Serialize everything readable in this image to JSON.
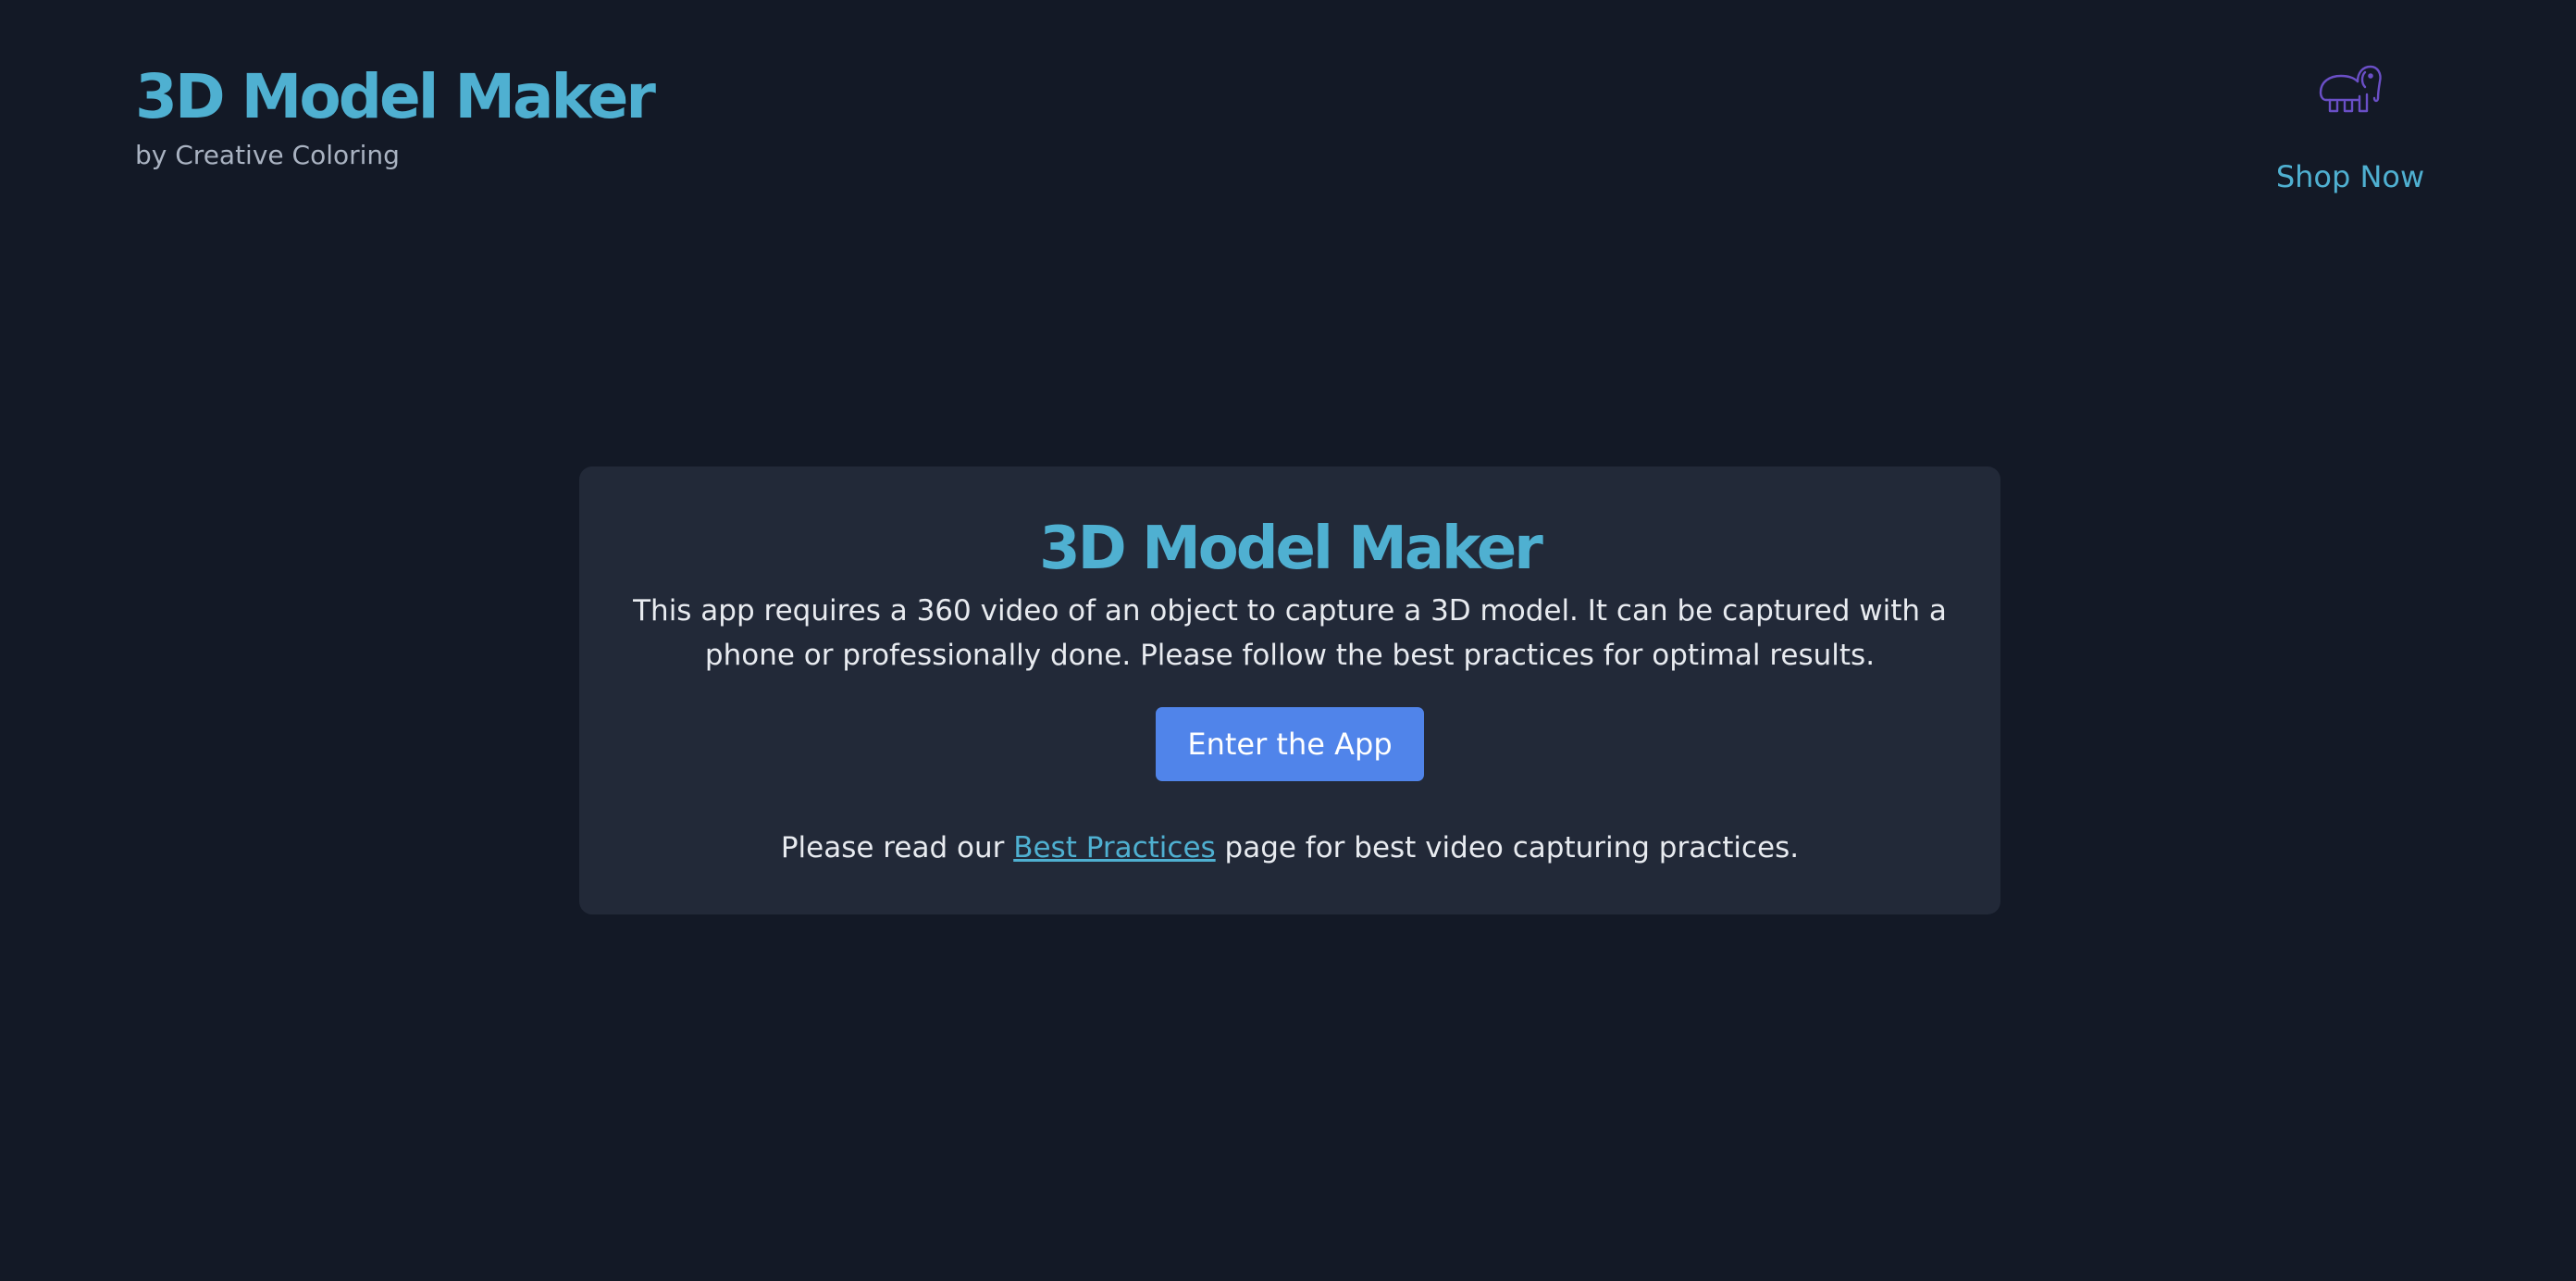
{
  "header": {
    "title": "3D Model Maker",
    "subtitle": "by Creative Coloring",
    "icon": "elephant-icon",
    "shop_label": "Shop Now"
  },
  "card": {
    "title": "3D Model Maker",
    "description": "This app requires a 360 video of an object to capture a 3D model. It can be captured with a phone or professionally done. Please follow the best practices for optimal results.",
    "button_label": "Enter the App",
    "note_prefix": "Please read our ",
    "note_link": "Best Practices",
    "note_suffix": " page for best video capturing practices."
  },
  "colors": {
    "background": "#131926",
    "card": "#222938",
    "accent": "#4fb0d1",
    "button": "#5084ea",
    "icon": "#6a4fc6"
  }
}
